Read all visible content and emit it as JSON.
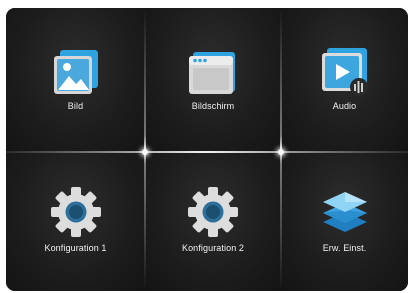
{
  "menu": {
    "tiles": [
      {
        "label": "Bild",
        "icon": "picture-icon"
      },
      {
        "label": "Bildschirm",
        "icon": "screen-window-icon"
      },
      {
        "label": "Audio",
        "icon": "audio-icon"
      },
      {
        "label": "Konfiguration 1",
        "icon": "gear-icon"
      },
      {
        "label": "Konfiguration 2",
        "icon": "gear-icon"
      },
      {
        "label": "Erw. Einst.",
        "icon": "layers-icon"
      }
    ]
  },
  "colors": {
    "panel_bg": "#111111",
    "icon_blue": "#2fa3e0",
    "icon_light_blue": "#5cc1ef",
    "icon_gray": "#d9d9d9",
    "gear_outer": "#dddddd",
    "gear_inner": "#2b6f9a",
    "text": "#f2f2f2"
  }
}
